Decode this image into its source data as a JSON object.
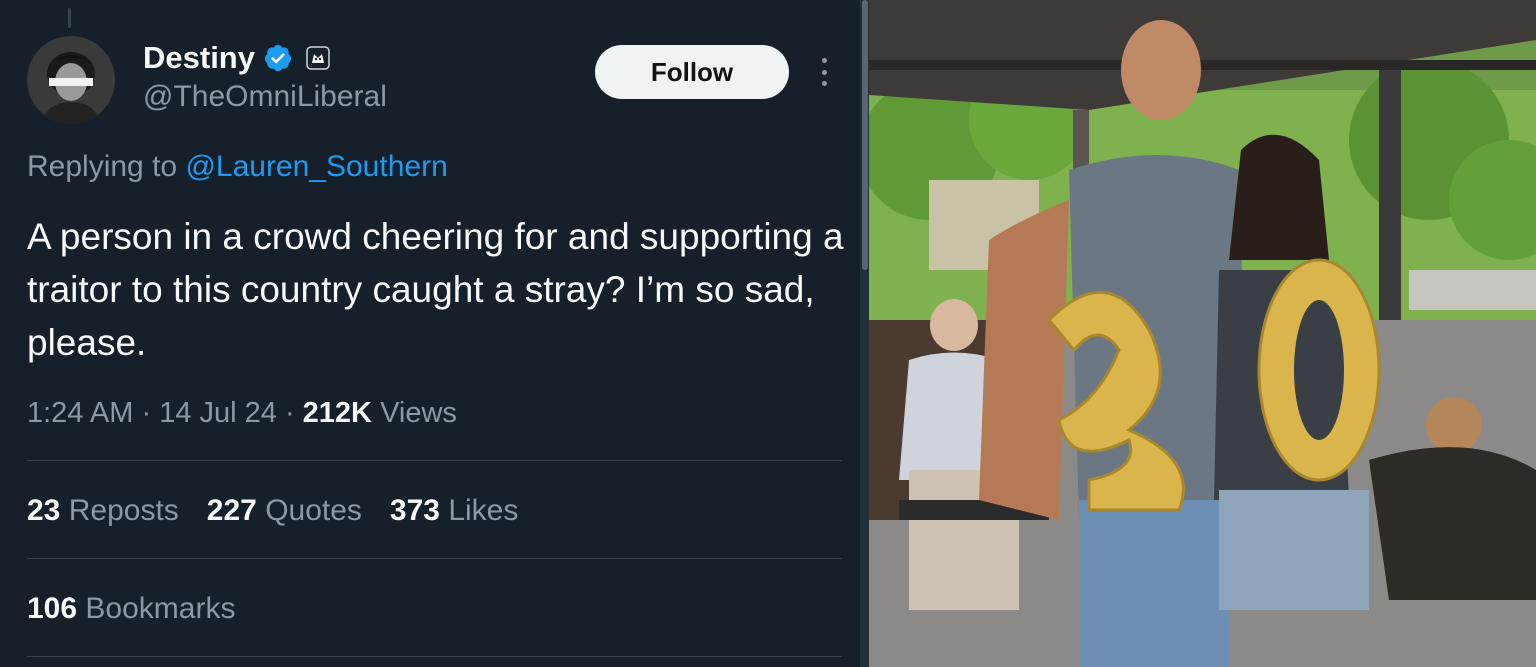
{
  "tweet": {
    "display_name": "Destiny",
    "handle": "@TheOmniLiberal",
    "follow_label": "Follow",
    "replying_prefix": "Replying to",
    "replying_to": "@Lauren_Southern",
    "text": "A person in a crowd cheering for and supporting a traitor to this country caught a stray? I’m so sad, please.",
    "time": "1:24 AM",
    "date": "14 Jul 24",
    "views_count": "212K",
    "views_label": "Views",
    "reposts_count": "23",
    "reposts_label": "Reposts",
    "quotes_count": "227",
    "quotes_label": "Quotes",
    "likes_count": "373",
    "likes_label": "Likes",
    "bookmarks_count": "106",
    "bookmarks_label": "Bookmarks"
  },
  "icons": {
    "verified": "verified-badge-icon",
    "affiliate": "affiliate-badge-icon",
    "more": "more-options-icon"
  },
  "colors": {
    "background": "#15202b",
    "text": "#f7f9f9",
    "secondary": "#8b98a5",
    "link": "#1d9bf0",
    "divider": "#38444d",
    "follow_bg": "#eff3f4"
  }
}
